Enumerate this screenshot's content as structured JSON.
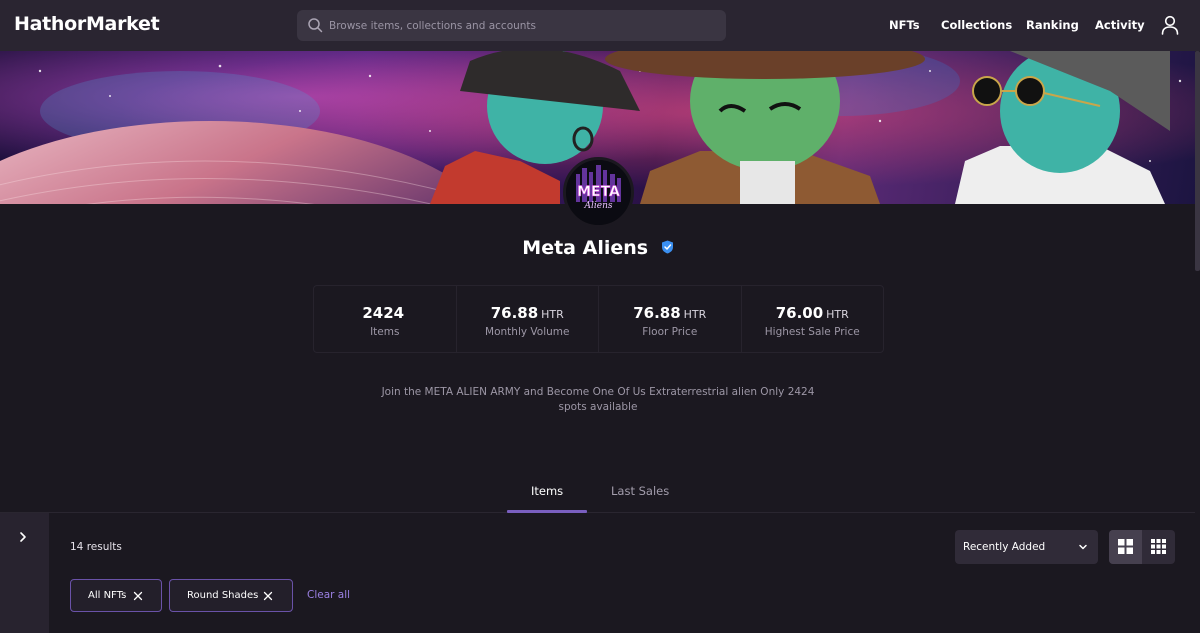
{
  "header": {
    "logo": "HathorMarket",
    "search_placeholder": "Browse items, collections and accounts",
    "nav": {
      "nfts": "NFTs",
      "collections": "Collections",
      "ranking": "Ranking",
      "activity": "Activity"
    }
  },
  "collection": {
    "name": "Meta Aliens",
    "avatar_text_top": "META",
    "avatar_text_bottom": "Aliens",
    "description": "Join the META ALIEN ARMY and Become One Of Us Extraterrestrial alien Only 2424 spots available"
  },
  "stats": [
    {
      "value": "2424",
      "unit": "",
      "label": "Items"
    },
    {
      "value": "76.88",
      "unit": "HTR",
      "label": "Monthly Volume"
    },
    {
      "value": "76.88",
      "unit": "HTR",
      "label": "Floor Price"
    },
    {
      "value": "76.00",
      "unit": "HTR",
      "label": "Highest Sale Price"
    }
  ],
  "tabs": {
    "items": "Items",
    "last_sales": "Last Sales"
  },
  "results": {
    "count_text": "14 results",
    "sort_selected": "Recently Added"
  },
  "filters": {
    "chips": [
      "All NFTs",
      "Round Shades"
    ],
    "clear_all": "Clear all"
  },
  "colors": {
    "accent": "#7a5fc0",
    "verified": "#3b8ff0",
    "header_bg": "#2a2531",
    "page_bg": "#1b1820"
  }
}
